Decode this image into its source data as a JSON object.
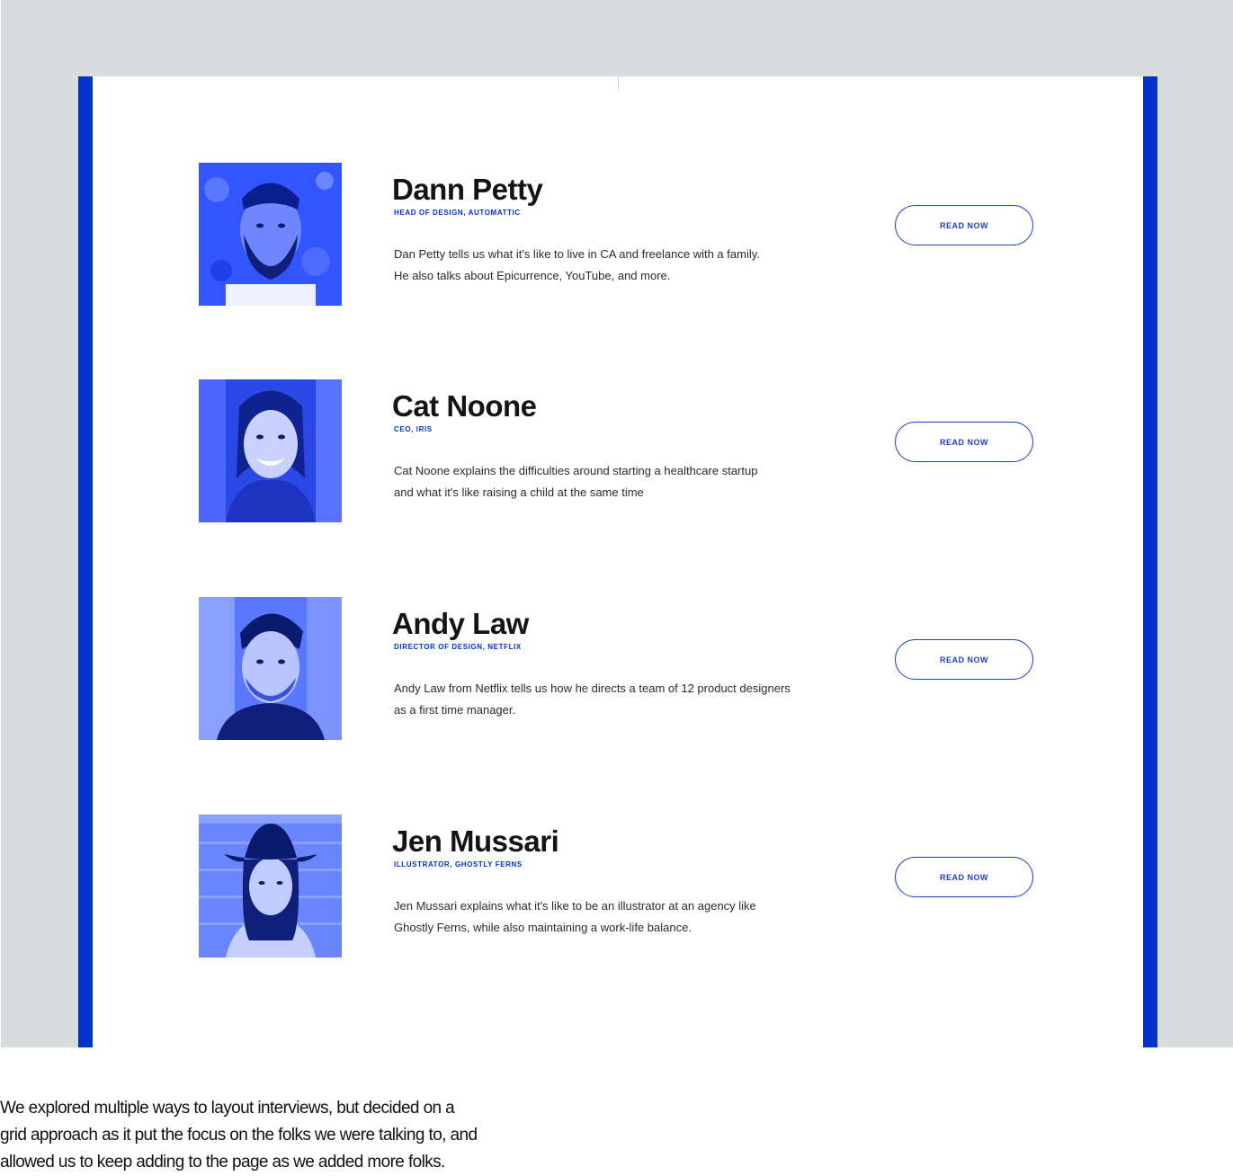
{
  "colors": {
    "accent": "#0033cc",
    "button_text": "#1f3fc4",
    "backdrop": "#d9dcde"
  },
  "interviews": [
    {
      "name": "Dann Petty",
      "role": "HEAD OF DESIGN, AUTOMATTIC",
      "description": [
        "Dan Petty tells us what it's like to live in CA and freelance with a family.",
        "He also talks about Epicurrence, YouTube, and more."
      ],
      "button_label": "READ NOW"
    },
    {
      "name": "Cat Noone",
      "role": "CEO, IRIS",
      "description": [
        "Cat Noone explains the difficulties around starting a healthcare startup",
        "and what it's like raising a child at the same time"
      ],
      "button_label": "READ NOW"
    },
    {
      "name": "Andy Law",
      "role": "DIRECTOR OF DESIGN, NETFLIX",
      "description": [
        "Andy Law from Netflix tells us how he directs a team of 12 product designers",
        "as a first time manager."
      ],
      "button_label": "READ NOW"
    },
    {
      "name": "Jen Mussari",
      "role": "ILLUSTRATOR, GHOSTLY FERNS",
      "description": [
        "Jen Mussari explains what it's like to be an illustrator at an agency like",
        "Ghostly Ferns, while also maintaining a work-life balance."
      ],
      "button_label": "READ NOW"
    }
  ],
  "caption": [
    "We explored multiple ways to layout interviews, but decided on a",
    "grid approach as it put the focus on the folks we were talking to, and",
    "allowed us to keep adding to the page as we added more folks."
  ]
}
